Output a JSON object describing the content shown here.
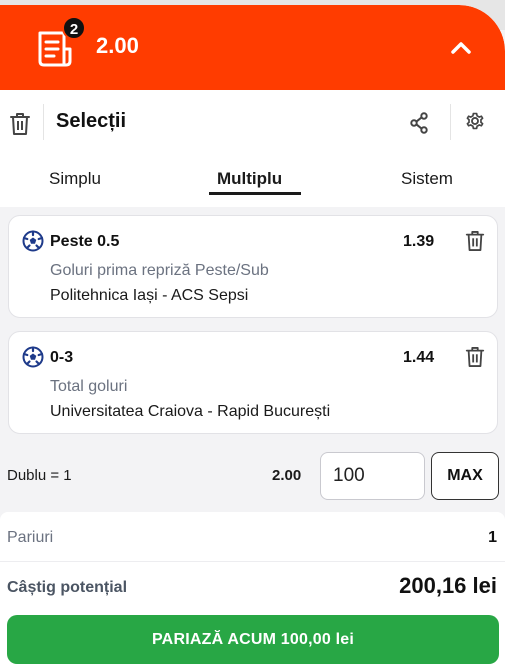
{
  "header": {
    "selection_count": "2",
    "total_odds": "2.00",
    "icon": "chevron-up-icon"
  },
  "toolbar": {
    "title": "Selecții",
    "icons": [
      "trash-icon",
      "share-icon",
      "gear-icon"
    ]
  },
  "tabs": [
    {
      "label": "Simplu",
      "active": false
    },
    {
      "label": "Multiplu",
      "active": true
    },
    {
      "label": "Sistem",
      "active": false
    }
  ],
  "selections": [
    {
      "pick": "Peste 0.5",
      "odds": "1.39",
      "market": "Goluri prima repriză Peste/Sub",
      "event": "Politehnica Iași - ACS Sepsi"
    },
    {
      "pick": "0-3",
      "odds": "1.44",
      "market": "Total goluri",
      "event": "Universitatea Craiova - Rapid București"
    }
  ],
  "combo": {
    "label": "Dublu = 1",
    "odds": "2.00",
    "stake": "100",
    "max_label": "MAX"
  },
  "summary": {
    "bets_label": "Pariuri",
    "bets_value": "1",
    "win_label": "Câștig potențial",
    "win_value": "200,16 lei",
    "place_label": "PARIAZĂ ACUM 100,00 lei"
  },
  "colors": {
    "accent": "#ff3c00",
    "confirm": "#28a745"
  }
}
